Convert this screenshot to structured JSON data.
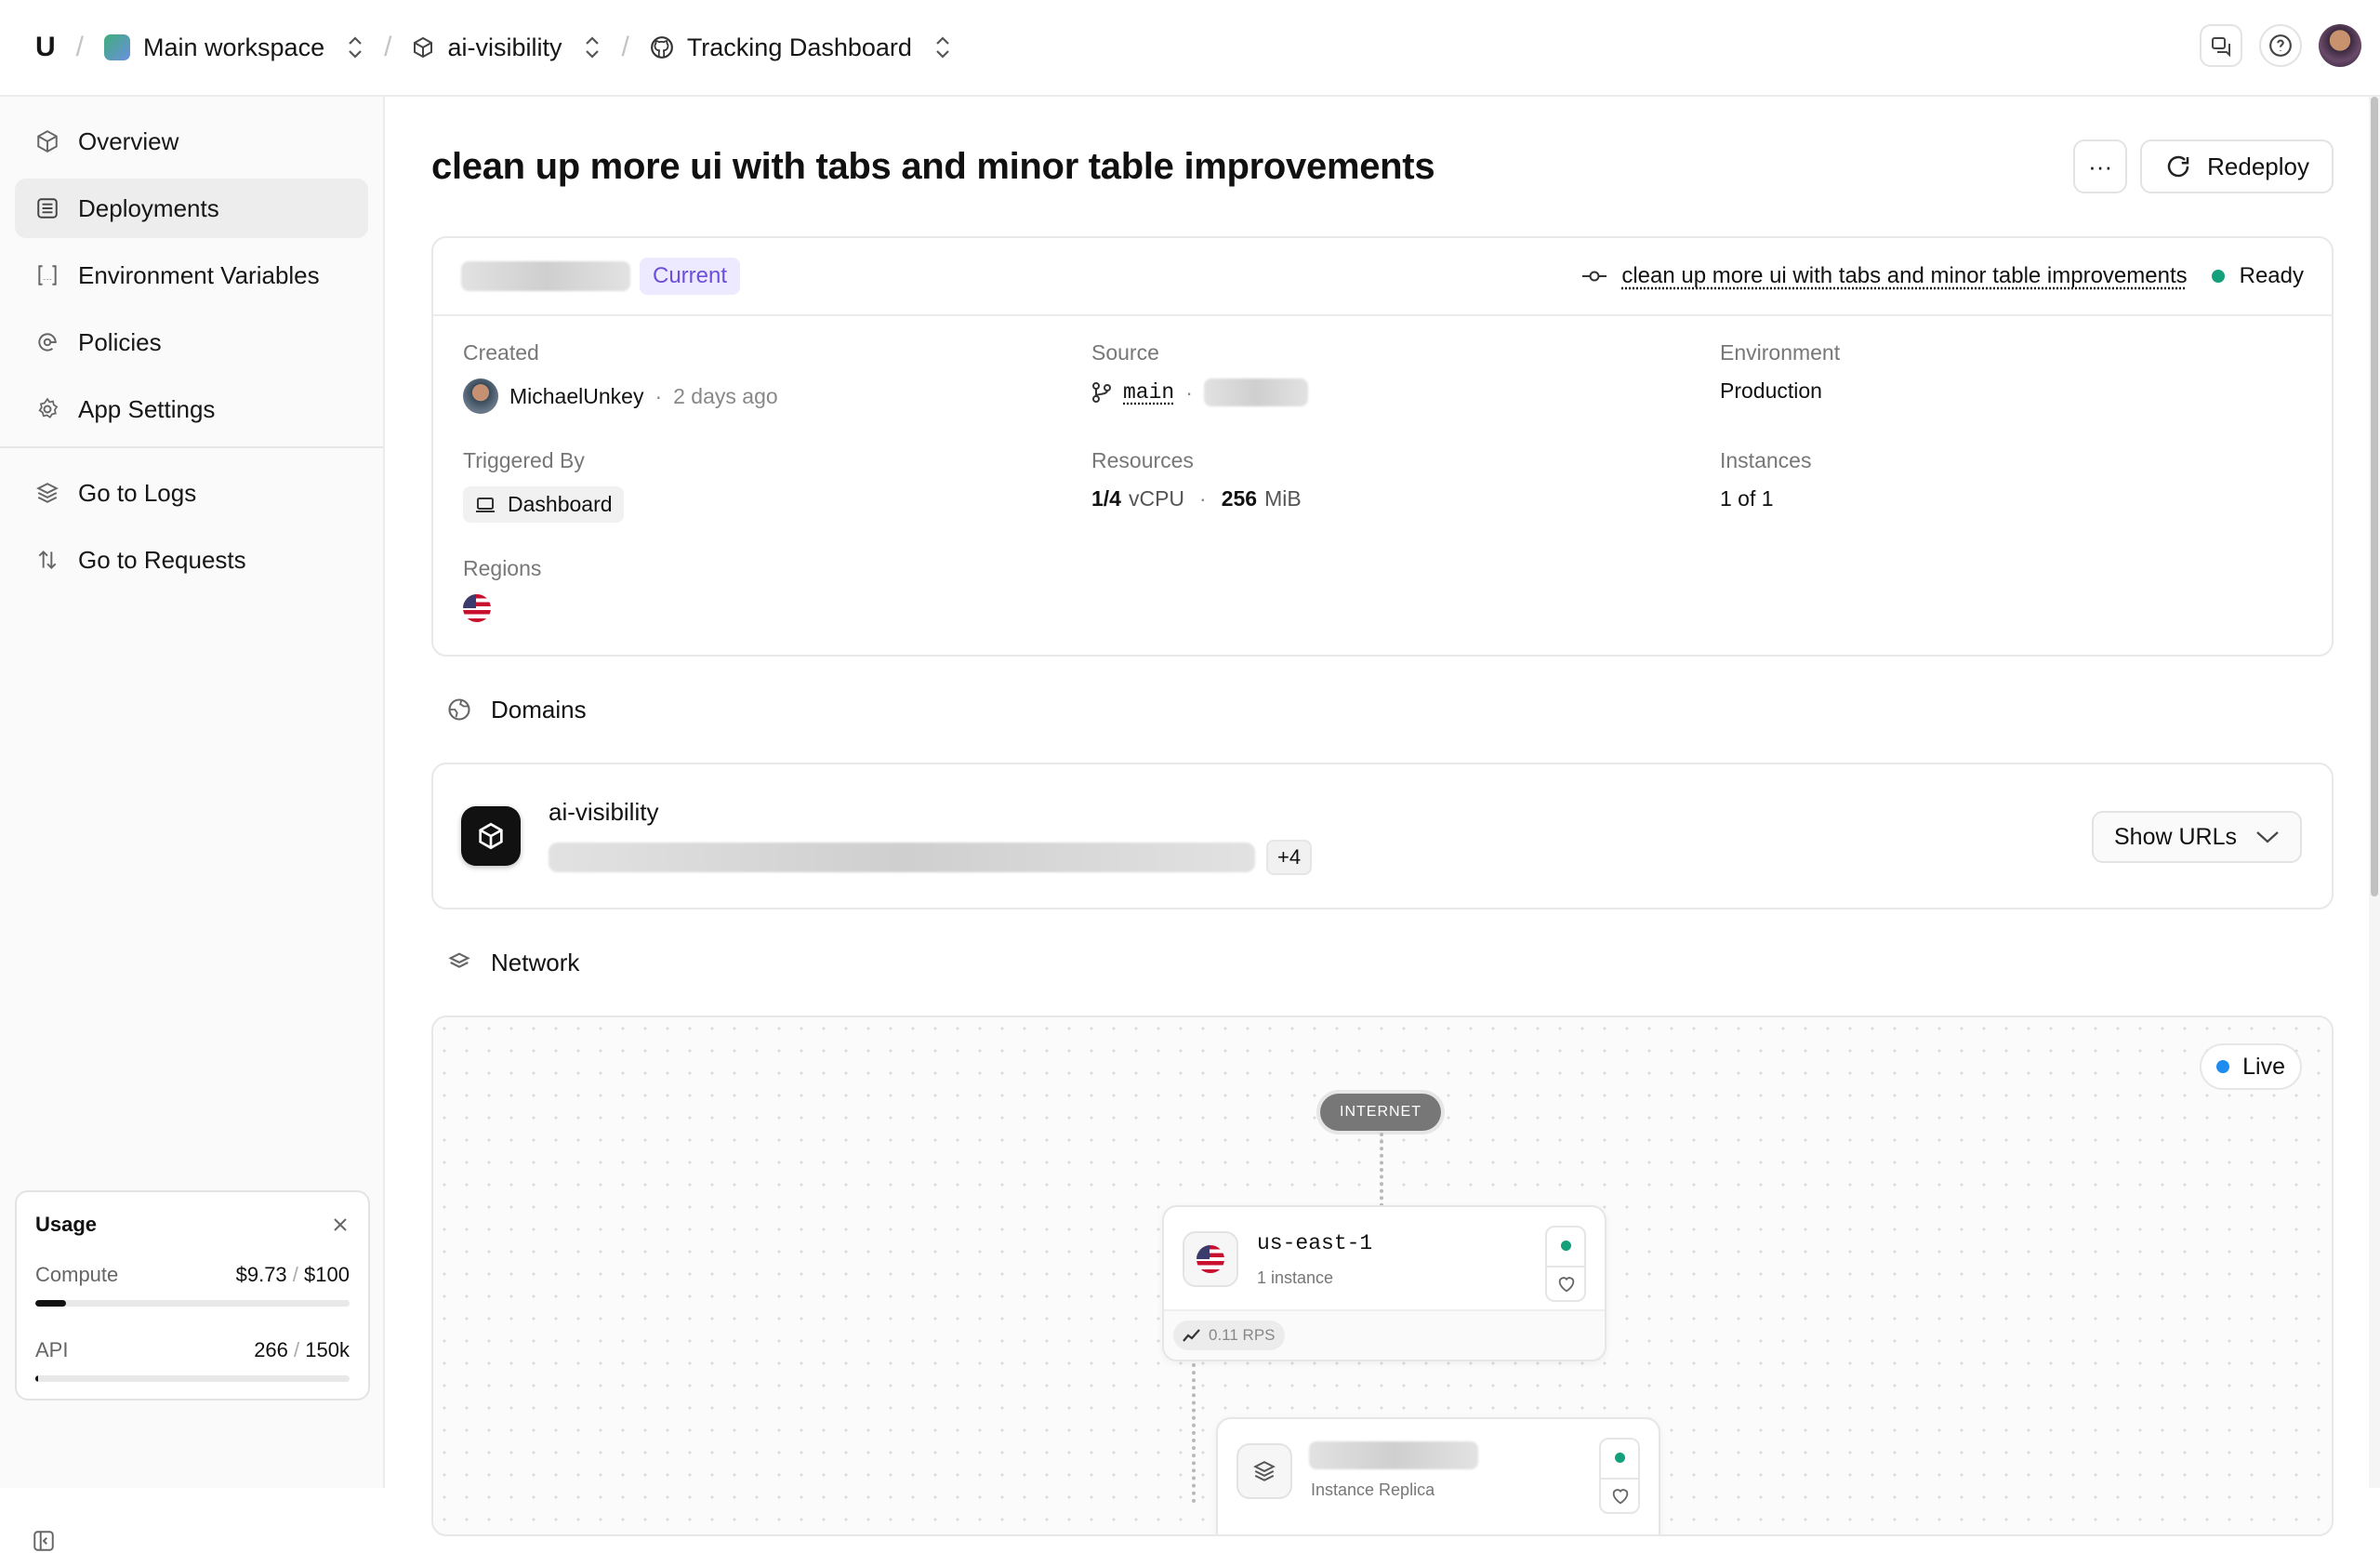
{
  "topbar": {
    "logo": "U",
    "workspace": "Main workspace",
    "project": "ai-visibility",
    "repo": "Tracking Dashboard",
    "separator": "/"
  },
  "sidebar": {
    "items": [
      {
        "label": "Overview",
        "icon": "cube-icon"
      },
      {
        "label": "Deployments",
        "icon": "list-icon",
        "active": true
      },
      {
        "label": "Environment Variables",
        "icon": "brackets-icon"
      },
      {
        "label": "Policies",
        "icon": "policy-icon"
      },
      {
        "label": "App Settings",
        "icon": "gear-icon"
      }
    ],
    "secondary": [
      {
        "label": "Go to Logs",
        "icon": "layers-icon"
      },
      {
        "label": "Go to Requests",
        "icon": "arrows-icon"
      }
    ],
    "usage": {
      "title": "Usage",
      "compute_label": "Compute",
      "compute_value": "$9.73",
      "compute_limit": "$100",
      "compute_fraction": 0.0973,
      "api_label": "API",
      "api_value": "266",
      "api_limit": "150k",
      "api_fraction": 0.0018,
      "slash": "/"
    }
  },
  "deployment": {
    "title": "clean up more ui with tabs and minor table improvements",
    "redeploy_label": "Redeploy",
    "more_label": "···",
    "badge": "Current",
    "commit_message": "clean up more ui with tabs and minor table improvements",
    "status": "Ready",
    "created_label": "Created",
    "created_by": "MichaelUnkey",
    "created_ago": "2 days ago",
    "dot_sep": "·",
    "source_label": "Source",
    "branch": "main",
    "environment_label": "Environment",
    "environment": "Production",
    "triggered_label": "Triggered By",
    "triggered_by": "Dashboard",
    "resources_label": "Resources",
    "cpu_value": "1/4",
    "cpu_unit": "vCPU",
    "mem_value": "256",
    "mem_unit": "MiB",
    "instances_label": "Instances",
    "instances": "1 of 1",
    "regions_label": "Regions"
  },
  "domains": {
    "title": "Domains",
    "name": "ai-visibility",
    "more_count": "+4",
    "show_urls_label": "Show URLs"
  },
  "network": {
    "title": "Network",
    "live_label": "Live",
    "internet_label": "INTERNET",
    "region_node": {
      "name": "us-east-1",
      "sub": "1 instance",
      "rps": "0.11 RPS"
    },
    "replica_node": {
      "sub": "Instance Replica"
    }
  },
  "colors": {
    "status_green": "#13a07a",
    "live_blue": "#1f8cf0",
    "badge_purple": "#6d4fd8"
  }
}
